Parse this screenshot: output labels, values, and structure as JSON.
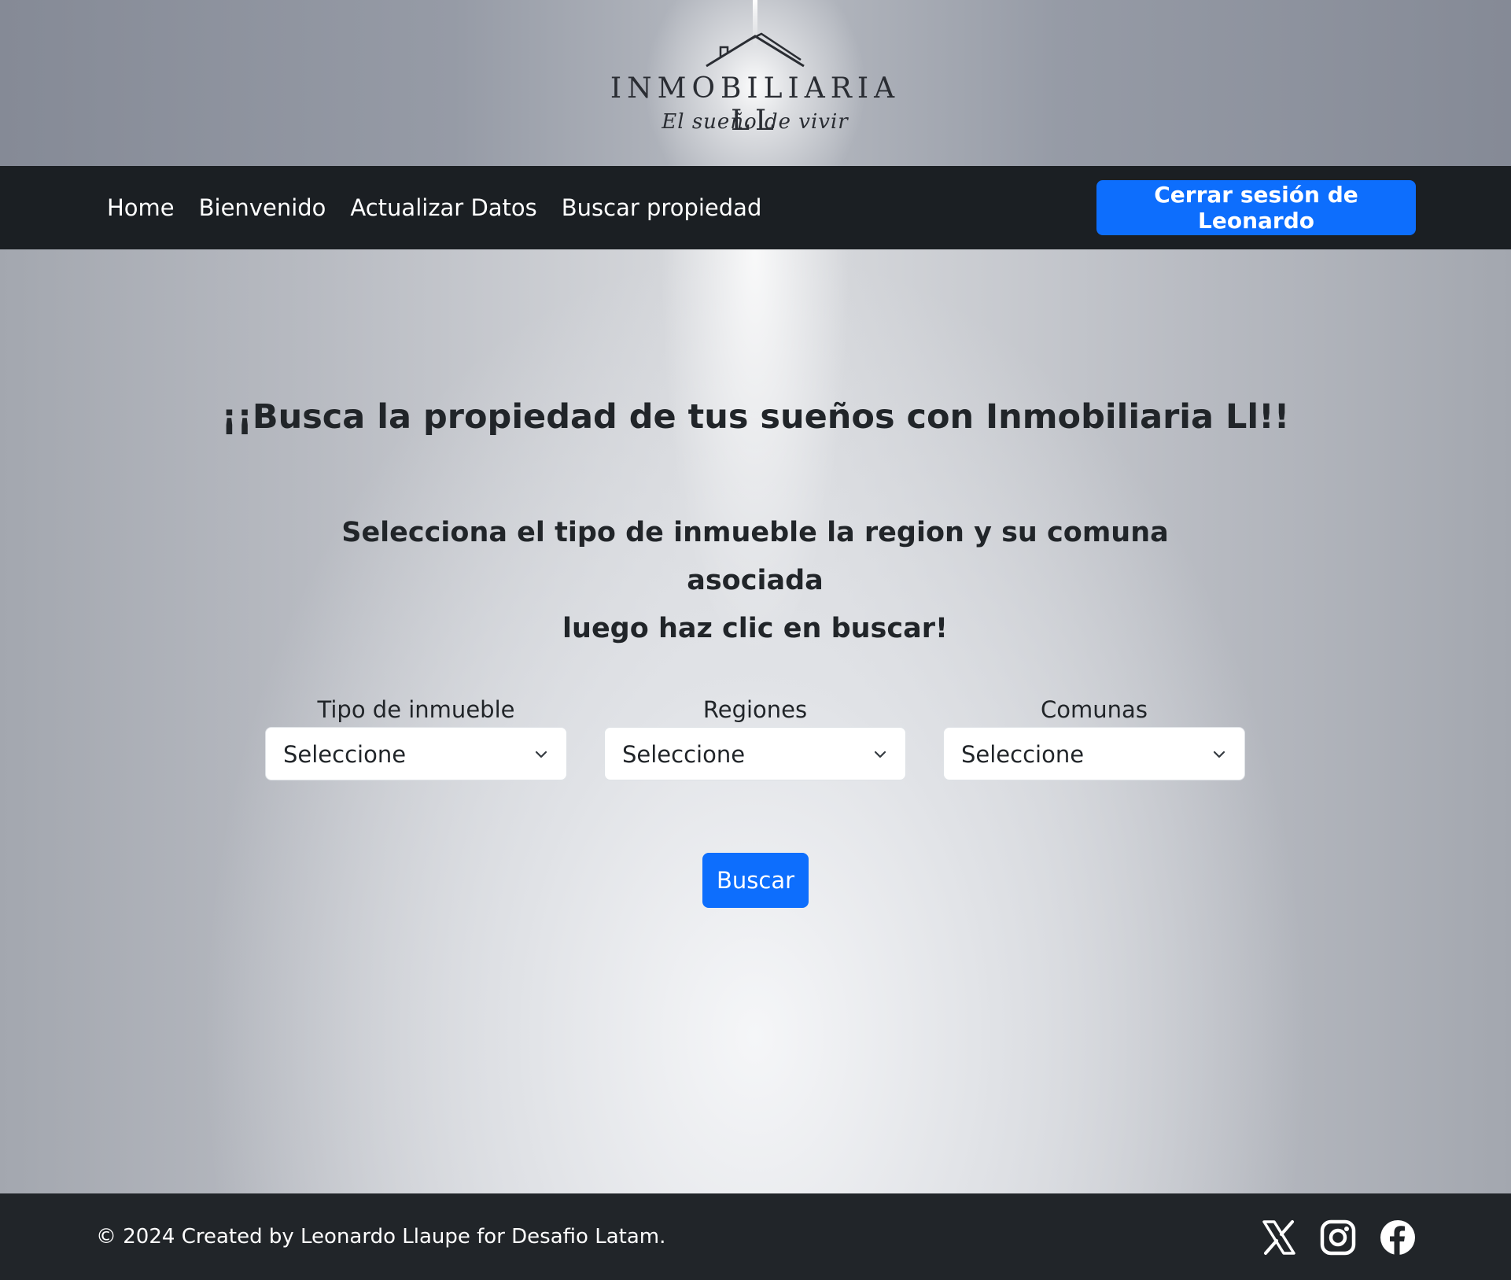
{
  "header": {
    "logo_title": "INMOBILIARIA LL",
    "logo_tagline": "El sueño de vivir"
  },
  "nav": {
    "links": [
      "Home",
      "Bienvenido",
      "Actualizar Datos",
      "Buscar propiedad"
    ],
    "logout_label": "Cerrar sesión de Leonardo"
  },
  "main": {
    "title": "¡¡Busca la propiedad de tus sueños con Inmobiliaria Ll!!",
    "subtitle_line1": "Selecciona el tipo de inmueble la region y su comuna asociada",
    "subtitle_line2": "luego haz clic en buscar!",
    "filters": [
      {
        "label": "Tipo de inmueble",
        "value": "Seleccione"
      },
      {
        "label": "Regiones",
        "value": "Seleccione"
      },
      {
        "label": "Comunas",
        "value": "Seleccione"
      }
    ],
    "search_label": "Buscar"
  },
  "footer": {
    "copyright": "© 2024 Created by Leonardo Llaupe for Desafio Latam.",
    "social_icons": [
      "x-icon",
      "instagram-icon",
      "facebook-icon"
    ]
  },
  "colors": {
    "primary": "#0d6efd",
    "navbar": "#1b1f23",
    "footer": "#212529"
  }
}
